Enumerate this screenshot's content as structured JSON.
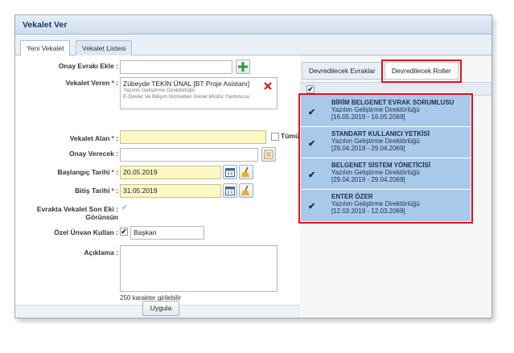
{
  "window": {
    "title": "Vekalet Ver"
  },
  "tabs": [
    {
      "label": "Yeni Vekalet",
      "active": true
    },
    {
      "label": "Vekalet Listesi",
      "active": false
    }
  ],
  "form": {
    "onay_evraki": {
      "label": "Onay Evrakı Ekle :"
    },
    "vekalet_veren": {
      "label": "Vekalet Veren",
      "name": "Zübeyde TEKİN ÜNAL [BT Proje Asistanı]",
      "dept": "Yazılım Geliştirme Direktörlüğü",
      "org": "E-Devlet Ve Bilişim Hizmetleri Genel Müdür Yardımcısı"
    },
    "vekalet_alan": {
      "label": "Vekalet Alan",
      "tumu": "Tümü"
    },
    "onay_verecek": {
      "label": "Onay Verecek :"
    },
    "baslangic": {
      "label": "Başlangıç Tarihi",
      "value": "20.05.2019"
    },
    "bitis": {
      "label": "Bitiş Tarihi",
      "value": "31.05.2019"
    },
    "evrakta": {
      "label_line1": "Evrakta Vekalet Son Eki :",
      "label_line2": "Görünsün"
    },
    "ozel_unvan": {
      "label": "Özel Ünvan Kullan :",
      "value": "Başkan"
    },
    "aciklama": {
      "label": "Açıklama :",
      "hint": "250 karakter girilebilir"
    },
    "submit": "Uygula",
    "colon": ":"
  },
  "right_tabs": [
    {
      "label": "Devredilecek Evraklar",
      "active": false
    },
    {
      "label": "Devredilecek Roller",
      "active": true
    }
  ],
  "roles": [
    {
      "name": "BİRİM BELGENET EVRAK SORUMLUSU",
      "dept": "Yazılım Geliştirme Direktörlüğü",
      "dates": "[16.05.2019 - 16.05.2069]"
    },
    {
      "name": "STANDART KULLANICI YETKİSİ",
      "dept": "Yazılım Geliştirme Direktörlüğü",
      "dates": "[29.04.2019 - 29.04.2069]"
    },
    {
      "name": "BELGENET SİSTEM YÖNETİCİSİ",
      "dept": "Yazılım Geliştirme Direktörlüğü",
      "dates": "[29.04.2019 - 29.04.2069]"
    },
    {
      "name": "ENTER ÖZER",
      "dept": "Yazılım Geliştirme Direktörlüğü",
      "dates": "[12.03.2019 - 12.03.2069]"
    }
  ],
  "colors": {
    "accent": "#a9c9ea",
    "highlight": "#d9151b",
    "required_bg": "#fdf7c3"
  }
}
